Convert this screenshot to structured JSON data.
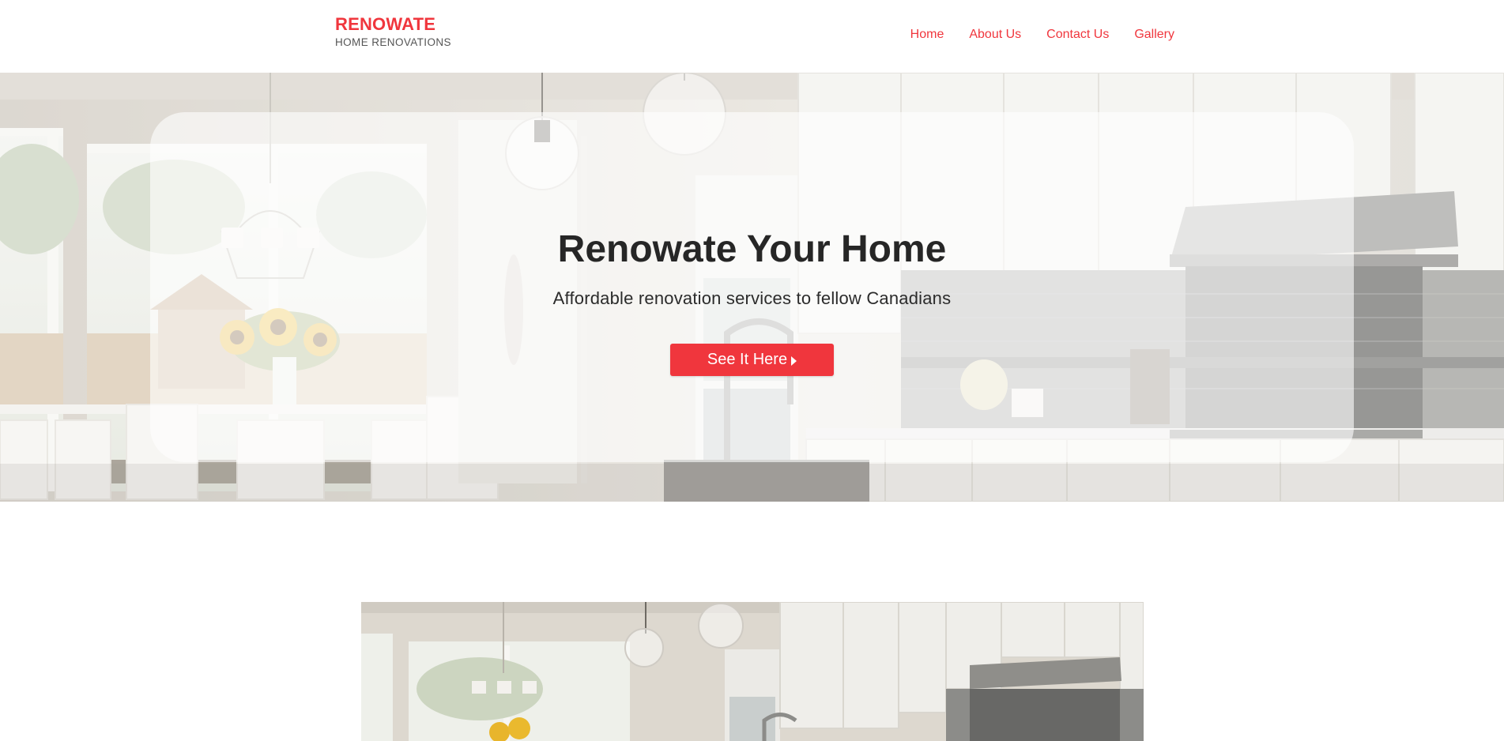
{
  "header": {
    "brand_name": "RENOWATE",
    "brand_tagline": "HOME RENOVATIONS",
    "nav": [
      {
        "label": "Home"
      },
      {
        "label": "About Us"
      },
      {
        "label": "Contact Us"
      },
      {
        "label": "Gallery"
      }
    ]
  },
  "hero": {
    "title": "Renowate Your Home",
    "subtitle": "Affordable renovation services to fellow Canadians",
    "cta_label": "See It Here",
    "cta_icon": "caret-right-icon",
    "background": "kitchen-photo"
  },
  "feature": {
    "image": "kitchen-photo"
  },
  "colors": {
    "accent": "#f0363d",
    "text_dark": "#262626",
    "tagline_gray": "#555555"
  }
}
